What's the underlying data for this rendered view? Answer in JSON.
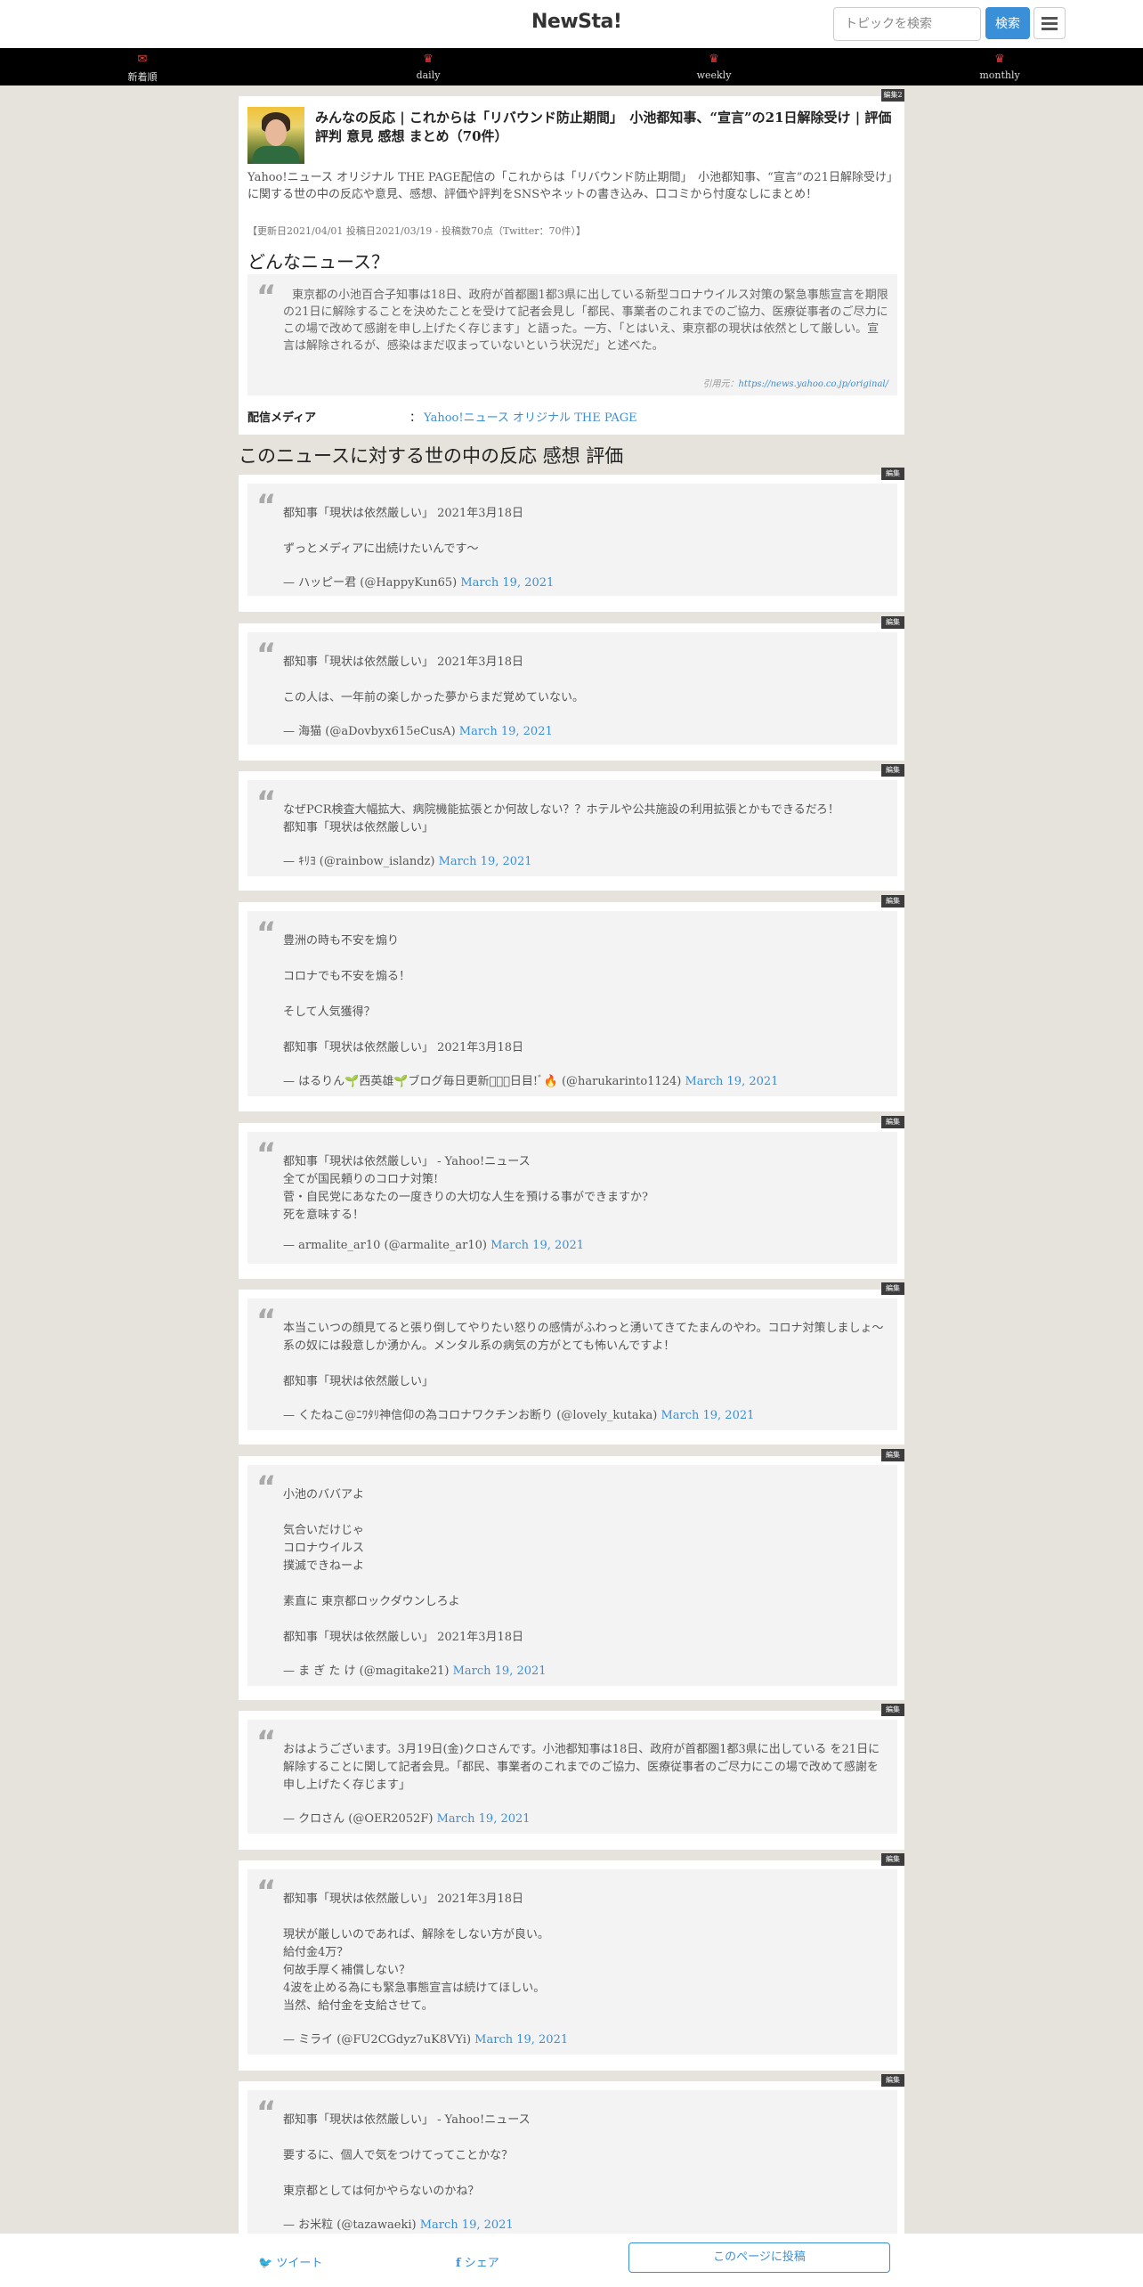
{
  "header": {
    "logo": "NewSta!",
    "search_placeholder": "トピックを検索",
    "search_button": "検索",
    "menu_icon": "hamburger-icon"
  },
  "nav": [
    {
      "label": "新着順",
      "icon": "envelope-icon"
    },
    {
      "label": "daily",
      "icon": "crown-icon"
    },
    {
      "label": "weekly",
      "icon": "crown-icon"
    },
    {
      "label": "monthly",
      "icon": "crown-icon"
    }
  ],
  "article": {
    "edit_tag": "編集2",
    "title": "みんなの反応 | これからは「リバウンド防止期間」　小池都知事、“宣言”の21日解除受け | 評価 評判 意見 感想 まとめ（70件）",
    "description": "Yahoo!ニュース オリジナル THE PAGE配信の「これからは「リバウンド防止期間」　小池都知事、“宣言”の21日解除受け」に関する世の中の反応や意見、感想、評価や評判をSNSやネットの書き込み、口コミから忖度なしにまとめ！",
    "meta": "【更新日2021/04/01 投稿日2021/03/19 - 投稿数70点（Twitter：70件）】",
    "section_heading": "どんなニュース？",
    "quote": "東京都の小池百合子知事は18日、政府が首都圏1都3県に出している新型コロナウイルス対策の緊急事態宣言を期限の21日に解除することを決めたことを受けて記者会見し「都民、事業者のこれまでのご協力、医療従事者のご尽力にこの場で改めて感謝を申し上げたく存じます」と語った。一方、「とはいえ、東京都の現状は依然として厳しい。宣言は解除されるが、感染はまだ収まっていないという状況だ」と述べた。",
    "quote_cite_prefix": "引用元：",
    "quote_cite_link": "https://news.yahoo.co.jp/original/",
    "media_label": "配信メディア",
    "media_sep": "：",
    "media_value": "Yahoo!ニュース オリジナル THE PAGE"
  },
  "reactions_heading": "このニュースに対する世の中の反応 感想 評価",
  "reactions": [
    {
      "tag": "編集",
      "body": "都知事「現状は依然厳しい」 2021年3月18日\n\nずっとメディアに出続けたいんです〜",
      "author": "— ハッピー君 (@HappyKun65)",
      "date": "March 19, 2021"
    },
    {
      "tag": "編集",
      "body": "都知事「現状は依然厳しい」 2021年3月18日\n\nこの人は、一年前の楽しかった夢からまだ覚めていない。",
      "author": "— 海猫 (@aDovbyx615eCusA)",
      "date": "March 19, 2021"
    },
    {
      "tag": "編集",
      "body": "なぜPCR検査大幅拡大、病院機能拡張とか何故しない？？ホテルや公共施設の利用拡張とかもできるだろ！\n都知事「現状は依然厳しい」",
      "author": "— ｷﾘﾖ (@rainbow_islandz)",
      "date": "March 19, 2021"
    },
    {
      "tag": "編集",
      "body": "豊洲の時も不安を煽り\n\nコロナでも不安を煽る！\n\nそして人気獲得？\n\n都知事「現状は依然厳しい」 2021年3月18日",
      "author": "— はるりん🌱西英雄🌱ブログ毎日更新󾓥󾓥󾓥日目!ﾞ🔥 (@harukarinto1124)",
      "date": "March 19, 2021"
    },
    {
      "tag": "編集",
      "body": "都知事「現状は依然厳しい」 - Yahoo!ニュース\n全てが国民頼りのコロナ対策!\n菅・自民党にあなたの一度きりの大切な人生を預ける事ができますか?\n死を意味する！",
      "author": "— armalite_ar10 (@armalite_ar10)",
      "date": "March 19, 2021"
    },
    {
      "tag": "編集",
      "body": "本当こいつの顔見てると張り倒してやりたい怒りの感情がふわっと湧いてきてたまんのやわ。コロナ対策しましょ～系の奴には殺意しか湧かん。メンタル系の病気の方がとても怖いんですよ！\n\n都知事「現状は依然厳しい」",
      "author": "— くたねこ@ﾆﾜﾀﾘ神信仰の為コロナワクチンお断り (@lovely_kutaka)",
      "date": "March 19, 2021"
    },
    {
      "tag": "編集",
      "body": "小池のババアよ\n\n気合いだけじゃ\nコロナウイルス\n撲滅できねーよ\n\n素直に 東京都ロックダウンしろよ\n\n都知事「現状は依然厳しい」 2021年3月18日",
      "author": "— ま ぎ た け (@magitake21)",
      "date": "March 19, 2021"
    },
    {
      "tag": "編集",
      "body": "おはようございます。3月19日(金)クロさんです。小池都知事は18日、政府が首都圏1都3県に出している を21日に解除することに関して記者会見。「都民、事業者のこれまでのご協力、医療従事者のご尽力にこの場で改めて感謝を申し上げたく存じます」",
      "author": "— クロさん (@OER2052F)",
      "date": "March 19, 2021"
    },
    {
      "tag": "編集",
      "body": "都知事「現状は依然厳しい」 2021年3月18日\n\n現状が厳しいのであれば、解除をしない方が良い。\n給付金4万？\n何故手厚く補償しない？\n4波を止める為にも緊急事態宣言は続けてほしい。\n当然、給付金を支給させて。",
      "author": "— ミライ (@FU2CGdyz7uK8VYi)",
      "date": "March 19, 2021"
    },
    {
      "tag": "編集",
      "body": "都知事「現状は依然厳しい」 - Yahoo!ニュース\n\n要するに、個人で気をつけてってことかな？\n\n東京都としては何かやらないのかね？",
      "author": "— お米粒 (@tazawaeki)",
      "date": "March 19, 2021"
    }
  ],
  "sharebar": {
    "tweet": "ツイート",
    "share": "シェア",
    "post": "このページに投稿"
  }
}
